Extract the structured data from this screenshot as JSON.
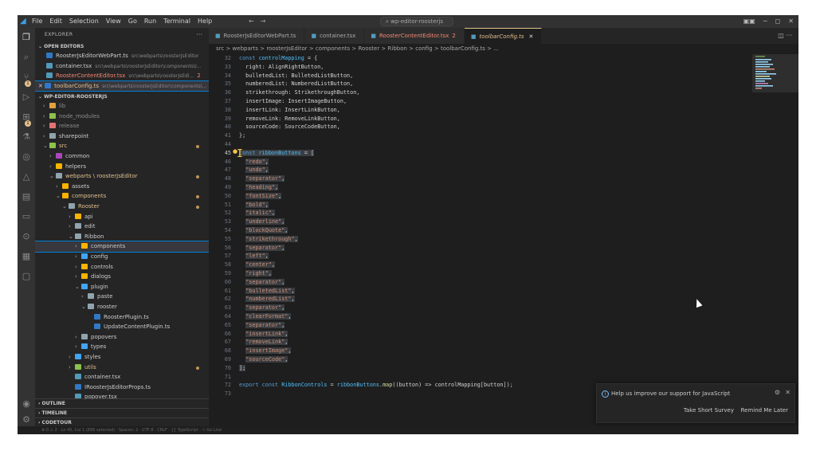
{
  "titlebar": {
    "menu": [
      "File",
      "Edit",
      "Selection",
      "View",
      "Go",
      "Run",
      "Terminal",
      "Help"
    ],
    "search": "wp-editor-roosterjs"
  },
  "sidebar": {
    "title": "EXPLORER",
    "open_editors_label": "OPEN EDITORS",
    "open_editors": [
      {
        "name": "RoosterJsEditorWebPart.ts",
        "path": "src\\webparts\\roosterJsEditor",
        "cls": "",
        "icon": "#3178c6"
      },
      {
        "name": "container.tsx",
        "path": "src\\webparts\\roosterJsEditor\\components\\I...",
        "cls": "",
        "icon": "#519aba"
      },
      {
        "name": "RoosterContentEditor.tsx",
        "path": "src\\webparts\\roosterJsEdi...",
        "extra": "2",
        "cls": "err",
        "icon": "#519aba"
      },
      {
        "name": "toolbarConfig.ts",
        "path": "src\\webparts\\roosterJsEditor\\components\\...",
        "cls": "mod",
        "icon": "#3178c6",
        "active": true
      }
    ],
    "project_label": "WP-EDITOR-ROOSTERJS",
    "tree": [
      {
        "d": 0,
        "t": "›",
        "n": "lib",
        "c": "#8c8c8c",
        "fi": "#e2a03f"
      },
      {
        "d": 0,
        "t": "›",
        "n": "node_modules",
        "c": "#8c8c8c",
        "fi": "#8bc34a"
      },
      {
        "d": 0,
        "t": "›",
        "n": "release",
        "c": "#8c8c8c",
        "fi": "#e57373"
      },
      {
        "d": 0,
        "t": "›",
        "n": "sharepoint",
        "c": "#ccc",
        "fi": "#90a4ae"
      },
      {
        "d": 0,
        "t": "⌄",
        "n": "src",
        "c": "#e2c08d",
        "fi": "#8bc34a",
        "dot": true
      },
      {
        "d": 1,
        "t": "›",
        "n": "common",
        "c": "#ccc",
        "fi": "#ab47bc"
      },
      {
        "d": 1,
        "t": "›",
        "n": "helpers",
        "c": "#ccc",
        "fi": "#ffb300"
      },
      {
        "d": 1,
        "t": "⌄",
        "n": "webparts \\ roosterJsEditor",
        "c": "#e2c08d",
        "fi": "#90a4ae",
        "dot": true
      },
      {
        "d": 2,
        "t": "›",
        "n": "assets",
        "c": "#ccc",
        "fi": "#ffb300"
      },
      {
        "d": 2,
        "t": "⌄",
        "n": "components",
        "c": "#e2c08d",
        "fi": "#ffb300",
        "dot": true
      },
      {
        "d": 3,
        "t": "⌄",
        "n": "Rooster",
        "c": "#e2c08d",
        "fi": "#90a4ae",
        "dot": true
      },
      {
        "d": 4,
        "t": "›",
        "n": "api",
        "c": "#ccc",
        "fi": "#ffb300"
      },
      {
        "d": 4,
        "t": "›",
        "n": "edit",
        "c": "#ccc",
        "fi": "#90a4ae"
      },
      {
        "d": 4,
        "t": "⌄",
        "n": "Ribbon",
        "c": "#ccc",
        "fi": "#90a4ae"
      },
      {
        "d": 5,
        "t": "›",
        "n": "components",
        "c": "#ccc",
        "fi": "#ffb300",
        "sel": true
      },
      {
        "d": 5,
        "t": "›",
        "n": "config",
        "c": "#ccc",
        "fi": "#42a5f5"
      },
      {
        "d": 5,
        "t": "›",
        "n": "controls",
        "c": "#ccc",
        "fi": "#ffb300"
      },
      {
        "d": 5,
        "t": "›",
        "n": "dialogs",
        "c": "#ccc",
        "fi": "#ffb300"
      },
      {
        "d": 5,
        "t": "⌄",
        "n": "plugin",
        "c": "#ccc",
        "fi": "#42a5f5"
      },
      {
        "d": 6,
        "t": "›",
        "n": "paste",
        "c": "#ccc",
        "fi": "#90a4ae"
      },
      {
        "d": 6,
        "t": "⌄",
        "n": "rooster",
        "c": "#ccc",
        "fi": "#90a4ae"
      },
      {
        "d": 7,
        "t": "",
        "n": "RoosterPlugin.ts",
        "c": "#ccc",
        "fi": "#3178c6"
      },
      {
        "d": 7,
        "t": "",
        "n": "UpdateContentPlugin.ts",
        "c": "#ccc",
        "fi": "#3178c6"
      },
      {
        "d": 5,
        "t": "›",
        "n": "popovers",
        "c": "#ccc",
        "fi": "#90a4ae"
      },
      {
        "d": 5,
        "t": "›",
        "n": "types",
        "c": "#ccc",
        "fi": "#42a5f5"
      },
      {
        "d": 4,
        "t": "›",
        "n": "styles",
        "c": "#ccc",
        "fi": "#42a5f5"
      },
      {
        "d": 4,
        "t": "›",
        "n": "utils",
        "c": "#e2c08d",
        "fi": "#8bc34a",
        "dot": true
      },
      {
        "d": 4,
        "t": "",
        "n": "container.tsx",
        "c": "#ccc",
        "fi": "#519aba"
      },
      {
        "d": 4,
        "t": "",
        "n": "IRoosterJsEditorProps.ts",
        "c": "#ccc",
        "fi": "#3178c6"
      },
      {
        "d": 4,
        "t": "",
        "n": "popover.tsx",
        "c": "#ccc",
        "fi": "#519aba"
      }
    ],
    "bottom_sections": [
      "OUTLINE",
      "TIMELINE",
      "CODETOUR"
    ]
  },
  "tabs": [
    {
      "label": "RoosterJsEditorWebPart.ts",
      "cls": ""
    },
    {
      "label": "container.tsx",
      "cls": ""
    },
    {
      "label": "RoosterContentEditor.tsx",
      "extra": "2",
      "cls": "err"
    },
    {
      "label": "toolbarConfig.ts",
      "cls": "mod",
      "active": true
    }
  ],
  "breadcrumb": "src > webparts > roosterJsEditor > components > Rooster > Ribbon > config > toolbarConfig.ts > ...",
  "code": {
    "lines": [
      {
        "n": "32",
        "html": "<span class='k'>const</span> <span class='v'>controlMapping</span> = {"
      },
      {
        "n": "33",
        "html": "  right: AlignRightButton,"
      },
      {
        "n": "34",
        "html": "  bulletedList: BulletedListButton,"
      },
      {
        "n": "35",
        "html": "  numberedList: NumberedListButton,"
      },
      {
        "n": "36",
        "html": "  strikethrough: StrikethroughButton,"
      },
      {
        "n": "37",
        "html": "  insertImage: InsertImageButton,"
      },
      {
        "n": "38",
        "html": "  insertLink: InsertLinkButton,"
      },
      {
        "n": "39",
        "html": "  removeLink: RemoveLinkButton,"
      },
      {
        "n": "40",
        "html": "  sourceCode: SourceCodeButton,"
      },
      {
        "n": "41",
        "html": "};"
      },
      {
        "n": "44",
        "html": ""
      },
      {
        "n": "45",
        "html": "<span class='hl'><span class='k'>const</span> <span class='v'>ribbonButtons</span> = [</span>",
        "cur": true
      },
      {
        "n": "46",
        "html": "  <span class='hl'><span class='s'>\"redo\"</span>,</span>"
      },
      {
        "n": "47",
        "html": "  <span class='hl'><span class='s'>\"undo\"</span>,</span>"
      },
      {
        "n": "48",
        "html": "  <span class='hl'><span class='s'>\"separator\"</span>,</span>"
      },
      {
        "n": "49",
        "html": "  <span class='hl'><span class='s'>\"heading\"</span>,</span>"
      },
      {
        "n": "50",
        "html": "  <span class='hl'><span class='s'>\"fontSize\"</span>,</span>"
      },
      {
        "n": "51",
        "html": "  <span class='hl'><span class='s'>\"bold\"</span>,</span>"
      },
      {
        "n": "52",
        "html": "  <span class='hl'><span class='s'>\"italic\"</span>,</span>"
      },
      {
        "n": "53",
        "html": "  <span class='hl'><span class='s'>\"underline\"</span>,</span>"
      },
      {
        "n": "54",
        "html": "  <span class='hl'><span class='s'>\"blockQuote\"</span>,</span>"
      },
      {
        "n": "55",
        "html": "  <span class='hl'><span class='s'>\"strikethrough\"</span>,</span>"
      },
      {
        "n": "56",
        "html": "  <span class='hl'><span class='s'>\"separator\"</span>,</span>"
      },
      {
        "n": "57",
        "html": "  <span class='hl'><span class='s'>\"left\"</span>,</span>"
      },
      {
        "n": "58",
        "html": "  <span class='hl'><span class='s'>\"center\"</span>,</span>"
      },
      {
        "n": "59",
        "html": "  <span class='hl'><span class='s'>\"right\"</span>,</span>"
      },
      {
        "n": "60",
        "html": "  <span class='hl'><span class='s'>\"separator\"</span>,</span>"
      },
      {
        "n": "61",
        "html": "  <span class='hl'><span class='s'>\"bulletedList\"</span>,</span>"
      },
      {
        "n": "62",
        "html": "  <span class='hl'><span class='s'>\"numberedList\"</span>,</span>"
      },
      {
        "n": "63",
        "html": "  <span class='hl'><span class='s'>\"separator\"</span>,</span>"
      },
      {
        "n": "64",
        "html": "  <span class='hl'><span class='s'>\"clearFormat\"</span>,</span>"
      },
      {
        "n": "65",
        "html": "  <span class='hl'><span class='s'>\"separator\"</span>,</span>"
      },
      {
        "n": "66",
        "html": "  <span class='hl'><span class='s'>\"insertLink\"</span>,</span>"
      },
      {
        "n": "67",
        "html": "  <span class='hl'><span class='s'>\"removeLink\"</span>,</span>"
      },
      {
        "n": "68",
        "html": "  <span class='hl'><span class='s'>\"insertImage\"</span>,</span>"
      },
      {
        "n": "69",
        "html": "  <span class='hl'><span class='s'>\"sourceCode\"</span>,</span>"
      },
      {
        "n": "70",
        "html": "<span class='hl'>];</span>"
      },
      {
        "n": "71",
        "html": ""
      },
      {
        "n": "72",
        "html": "<span class='k'>export</span> <span class='k'>const</span> <span class='v'>RibbonControls</span> = <span class='v'>ribbonButtons</span>.<span class='f'>map</span>((button) => controlMapping[button]);"
      },
      {
        "n": "73",
        "html": ""
      }
    ]
  },
  "toast": {
    "message": "Help us improve our support for JavaScript",
    "primary": "Take Short Survey",
    "secondary": "Remind Me Later"
  }
}
